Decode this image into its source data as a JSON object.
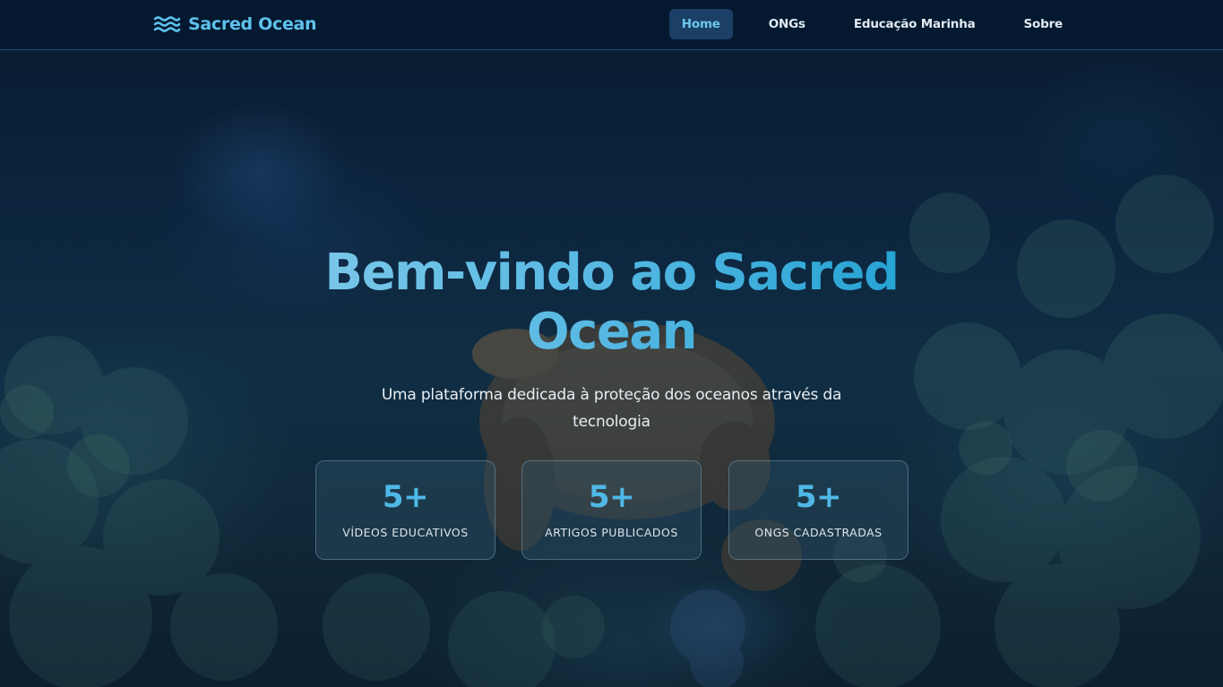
{
  "navbar": {
    "brand_icon": "waves-icon",
    "brand_name": "Sacred Ocean",
    "links": [
      {
        "label": "Home",
        "active": true
      },
      {
        "label": "ONGs",
        "active": false
      },
      {
        "label": "Educação Marinha",
        "active": false
      },
      {
        "label": "Sobre",
        "active": false
      }
    ]
  },
  "hero": {
    "title_line1": "Bem-vindo ao Sacred",
    "title_line2": "Ocean",
    "subtitle_line1": "Uma plataforma dedicada à proteção dos oceanos através da",
    "subtitle_line2": "tecnologia"
  },
  "stats": [
    {
      "value": "5+",
      "label": "VÍDEOS EDUCATIVOS"
    },
    {
      "value": "5+",
      "label": "ARTIGOS PUBLICADOS"
    },
    {
      "value": "5+",
      "label": "ONGS CADASTRADAS"
    }
  ],
  "colors": {
    "accent": "#5ec1ec",
    "navbar_bg": "#041a30",
    "stat_value": "#4fb8e6"
  }
}
